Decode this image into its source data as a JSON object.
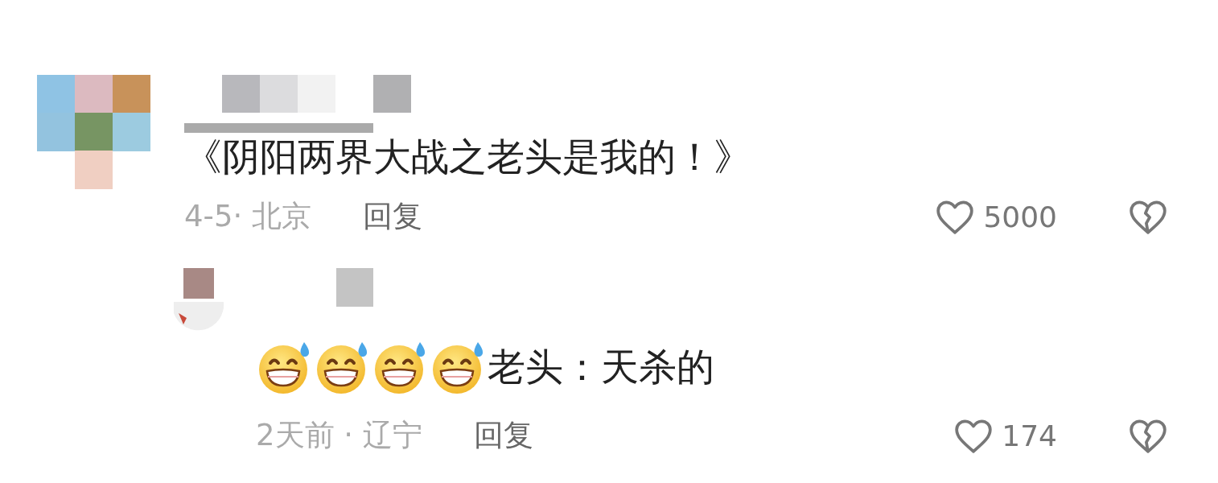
{
  "comments": [
    {
      "content": [
        {
          "kind": "text",
          "text": "《阴阳两界大战之老头是我的！》"
        }
      ],
      "meta": "4-5· 北京",
      "reply_label": "回复",
      "likes": "5000",
      "replies": [
        {
          "content": [
            {
              "kind": "emoji"
            },
            {
              "kind": "emoji"
            },
            {
              "kind": "emoji"
            },
            {
              "kind": "emoji"
            },
            {
              "kind": "text",
              "text": "老头：天杀的"
            }
          ],
          "meta": "2天前 · 辽宁",
          "reply_label": "回复",
          "likes": "174"
        }
      ]
    }
  ]
}
